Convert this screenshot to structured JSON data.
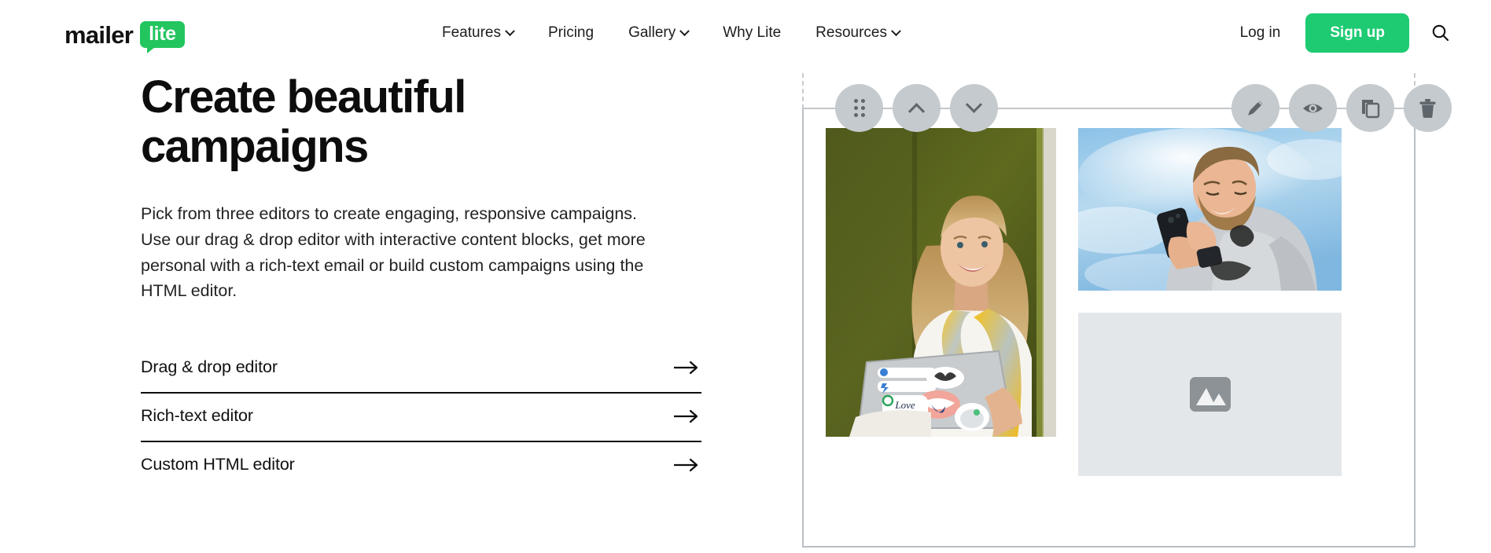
{
  "header": {
    "logo": {
      "text_primary": "mailer",
      "text_badge": "lite",
      "badge_color": "#22C55E"
    },
    "nav": [
      {
        "label": "Features",
        "has_dropdown": true
      },
      {
        "label": "Pricing",
        "has_dropdown": false
      },
      {
        "label": "Gallery",
        "has_dropdown": true
      },
      {
        "label": "Why Lite",
        "has_dropdown": false
      },
      {
        "label": "Resources",
        "has_dropdown": true
      }
    ],
    "login_label": "Log in",
    "signup_label": "Sign up",
    "signup_color": "#1ECB73",
    "search_icon": "search-icon"
  },
  "hero": {
    "title": "Create beautiful campaigns",
    "description": "Pick from three editors to create engaging, responsive campaigns. Use our drag & drop editor with interactive content blocks, get more personal with a rich-text email or build custom campaigns using the HTML editor.",
    "links": [
      {
        "label": "Drag & drop editor",
        "arrow": "arrow-right-icon"
      },
      {
        "label": "Rich-text editor",
        "arrow": "arrow-right-icon"
      },
      {
        "label": "Custom HTML editor",
        "arrow": "arrow-right-icon"
      }
    ]
  },
  "editor_preview": {
    "toolbar_left": [
      {
        "name": "drag-handle-icon"
      },
      {
        "name": "move-up-icon"
      },
      {
        "name": "move-down-icon"
      }
    ],
    "toolbar_right": [
      {
        "name": "edit-pencil-icon"
      },
      {
        "name": "preview-eye-icon"
      },
      {
        "name": "duplicate-icon"
      },
      {
        "name": "delete-trash-icon"
      }
    ],
    "blocks": [
      {
        "name": "photo-woman-with-laptop",
        "type": "image"
      },
      {
        "name": "photo-man-with-phone",
        "type": "image"
      },
      {
        "name": "empty-image-placeholder",
        "type": "placeholder",
        "icon": "image-placeholder-icon"
      }
    ],
    "border_color": "#b9bfc4",
    "toolbar_button_color": "#c4cacd"
  }
}
